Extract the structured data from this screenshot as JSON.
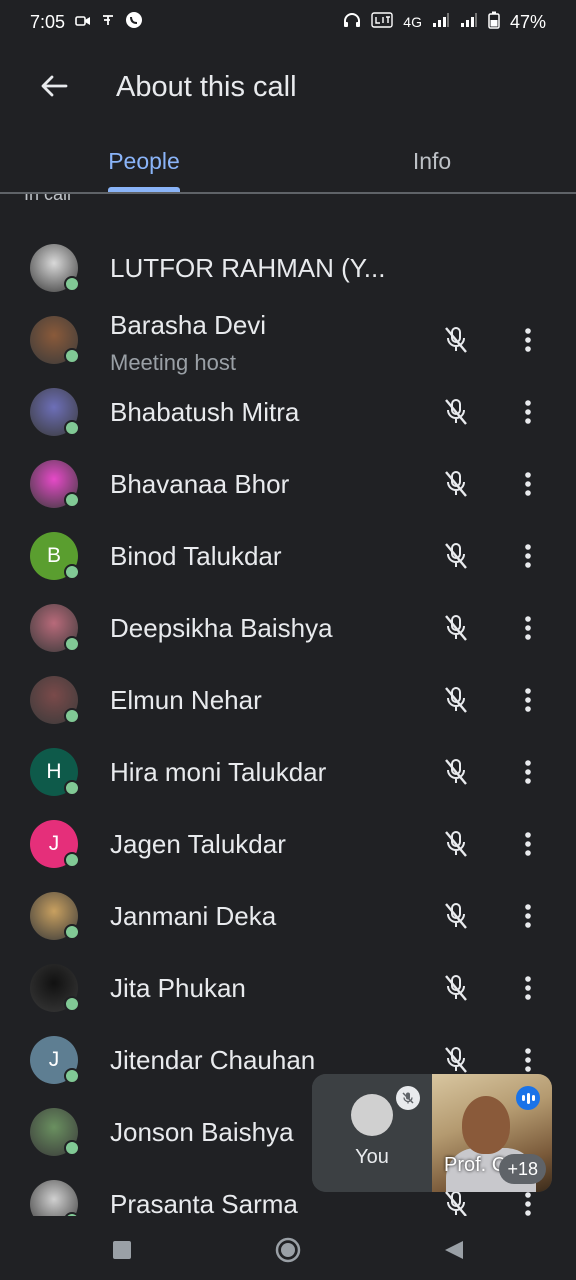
{
  "status_bar": {
    "time": "7:05",
    "left_icons": [
      "video-icon",
      "notification-icon",
      "whatsapp-icon"
    ],
    "network_label": "4G",
    "battery_text": "47%"
  },
  "app_bar": {
    "title": "About this call"
  },
  "tabs": [
    {
      "label": "People",
      "active": true
    },
    {
      "label": "Info",
      "active": false
    }
  ],
  "section_label": "In call",
  "participants": [
    {
      "name": "LUTFOR RAHMAN (Y...",
      "avatar_color": "#d9d9d9",
      "photo": true,
      "muted": false
    },
    {
      "name": "Barasha Devi",
      "subtitle": "Meeting host",
      "avatar_color": "#8a5a3a",
      "photo": true,
      "muted": true
    },
    {
      "name": "Bhabatush Mitra",
      "avatar_color": "#6d6fb8",
      "photo": true,
      "muted": true
    },
    {
      "name": "Bhavanaa Bhor",
      "avatar_color": "#e64ac8",
      "photo": true,
      "muted": true
    },
    {
      "name": "Binod Talukdar",
      "initial": "B",
      "avatar_color": "#5a9e2f",
      "muted": true
    },
    {
      "name": "Deepsikha Baishya",
      "avatar_color": "#b86a7a",
      "photo": true,
      "muted": true
    },
    {
      "name": "Elmun Nehar",
      "avatar_color": "#7a4a4a",
      "photo": true,
      "muted": true
    },
    {
      "name": "Hira moni Talukdar",
      "initial": "H",
      "avatar_color": "#0e5a4a",
      "muted": true
    },
    {
      "name": "Jagen Talukdar",
      "initial": "J",
      "avatar_color": "#e52f7a",
      "muted": true
    },
    {
      "name": "Janmani Deka",
      "avatar_color": "#c8a060",
      "photo": true,
      "muted": true
    },
    {
      "name": "Jita Phukan",
      "avatar_color": "#111111",
      "photo": true,
      "muted": true
    },
    {
      "name": "Jitendar Chauhan",
      "initial": "J",
      "avatar_color": "#5e7e92",
      "muted": true
    },
    {
      "name": "Jonson Baishya",
      "avatar_color": "#6a9060",
      "photo": true,
      "muted": true
    },
    {
      "name": "Prasanta Sarma",
      "avatar_color": "#d0d0d0",
      "photo": true,
      "muted": true
    }
  ],
  "pip": {
    "self_label": "You",
    "remote_label": "Prof. C",
    "count_label": "+18"
  },
  "colors": {
    "background": "#202124",
    "accent": "#8ab4f8",
    "online": "#81c995"
  }
}
